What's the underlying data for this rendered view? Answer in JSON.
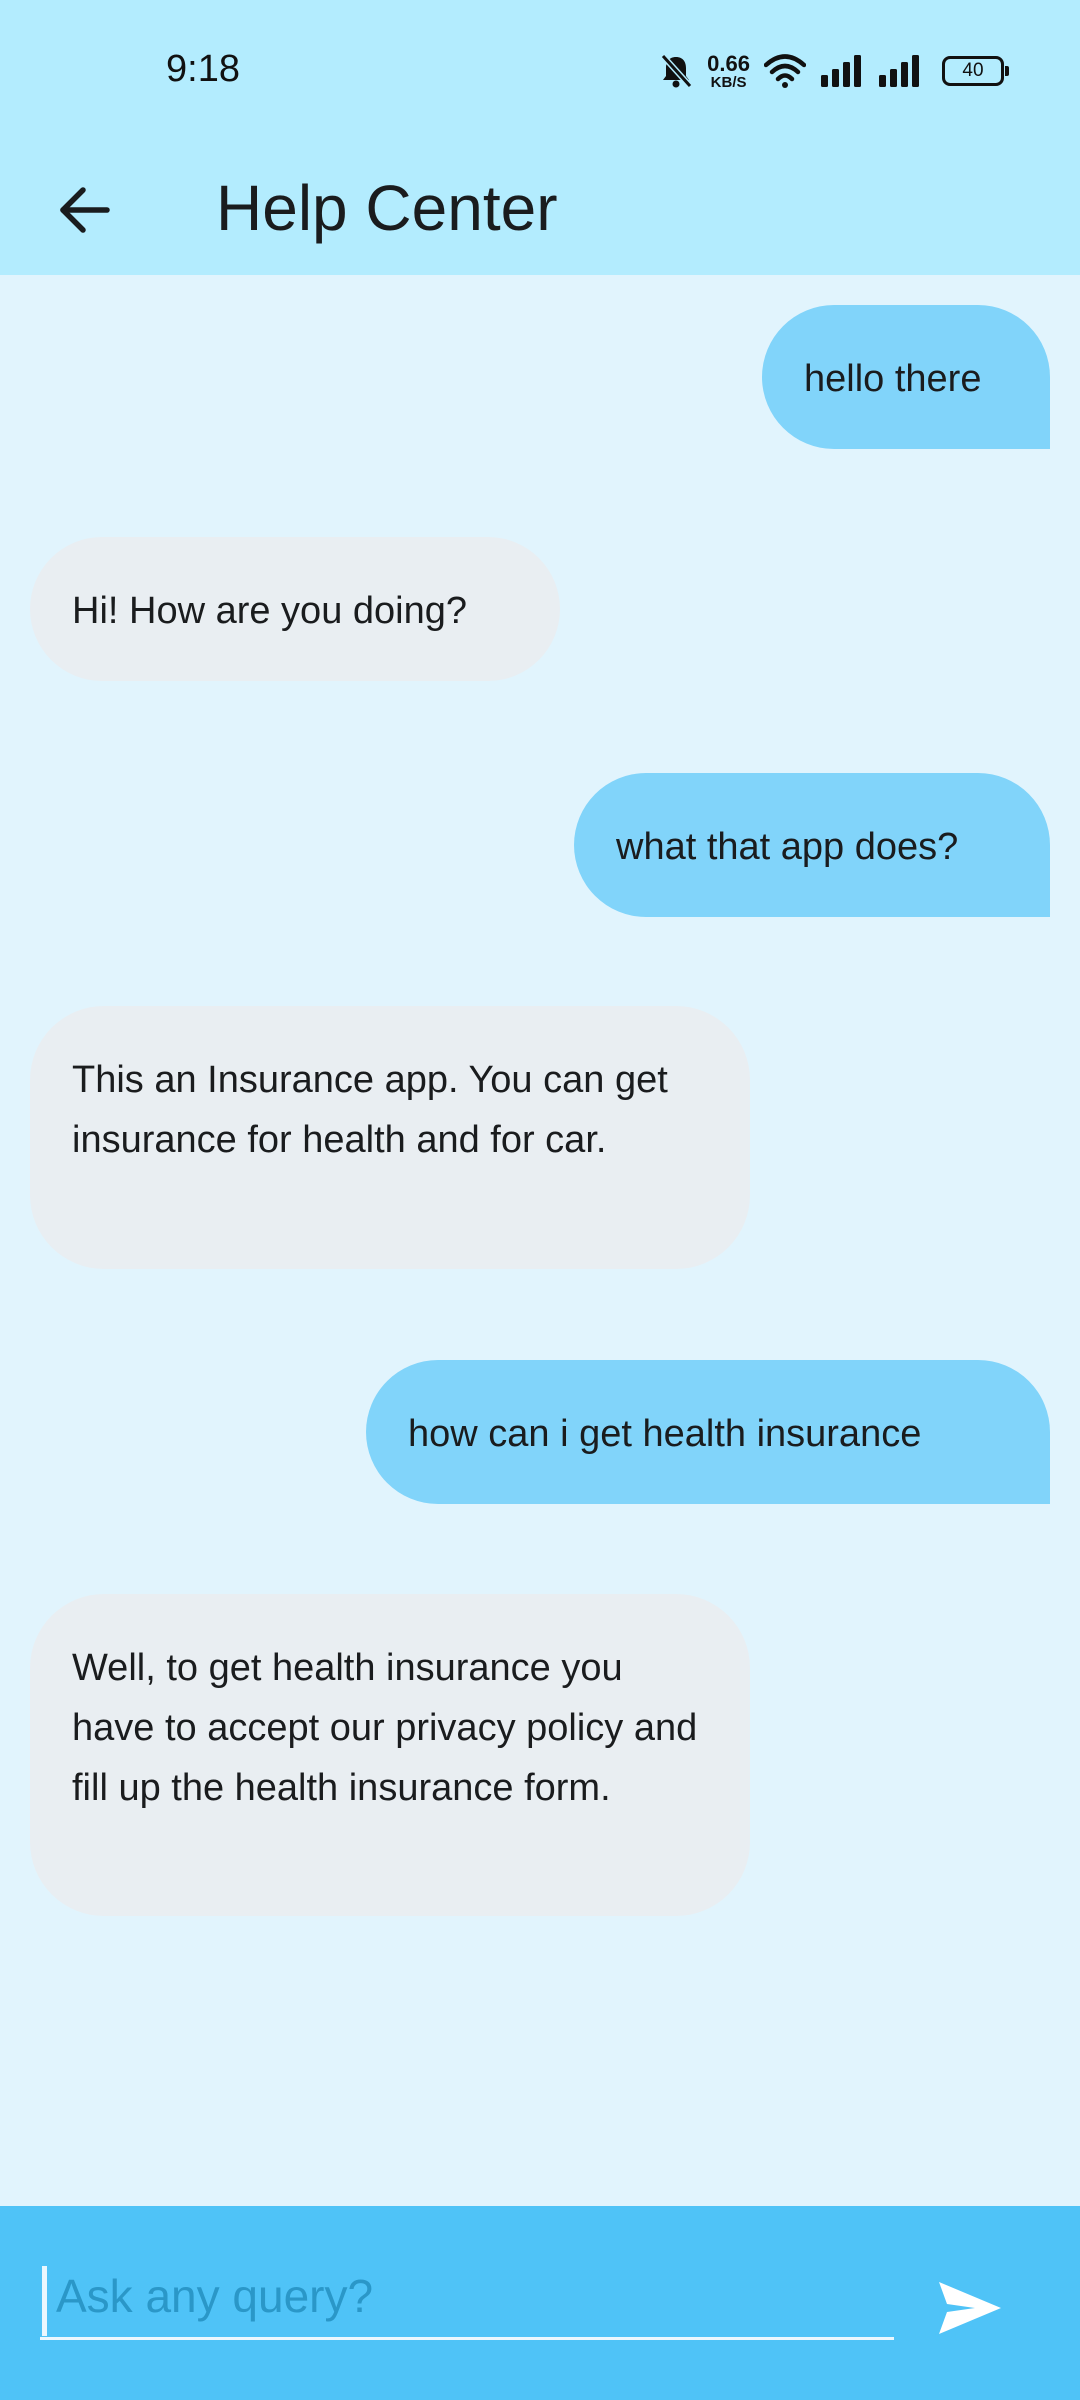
{
  "status_bar": {
    "time": "9:18",
    "net_speed_value": "0.66",
    "net_speed_unit": "KB/S",
    "battery": "40",
    "icons": [
      "bell-off-icon",
      "wifi-icon",
      "signal-icon",
      "signal-icon",
      "battery-icon"
    ]
  },
  "app_bar": {
    "title": "Help Center",
    "back_icon": "arrow-back-icon"
  },
  "messages": [
    {
      "sender": "user",
      "text": "hello there"
    },
    {
      "sender": "bot",
      "text": "Hi! How are you doing?"
    },
    {
      "sender": "user",
      "text": "what that app does?"
    },
    {
      "sender": "bot",
      "text": "This an Insurance app. You can get insurance for health and for car."
    },
    {
      "sender": "user",
      "text": "how can i get health insurance"
    },
    {
      "sender": "bot",
      "text": "Well, to get health insurance you have to accept our privacy policy and fill up the health insurance form."
    }
  ],
  "input": {
    "value": "",
    "placeholder": "Ask any query?",
    "send_icon": "send-icon"
  },
  "colors": {
    "app_bar": "#b3ecfe",
    "background": "#e1f4fd",
    "sent_bubble": "#81d4fa",
    "received_bubble": "#e9eef2",
    "input_bar": "#4fc3f7"
  }
}
